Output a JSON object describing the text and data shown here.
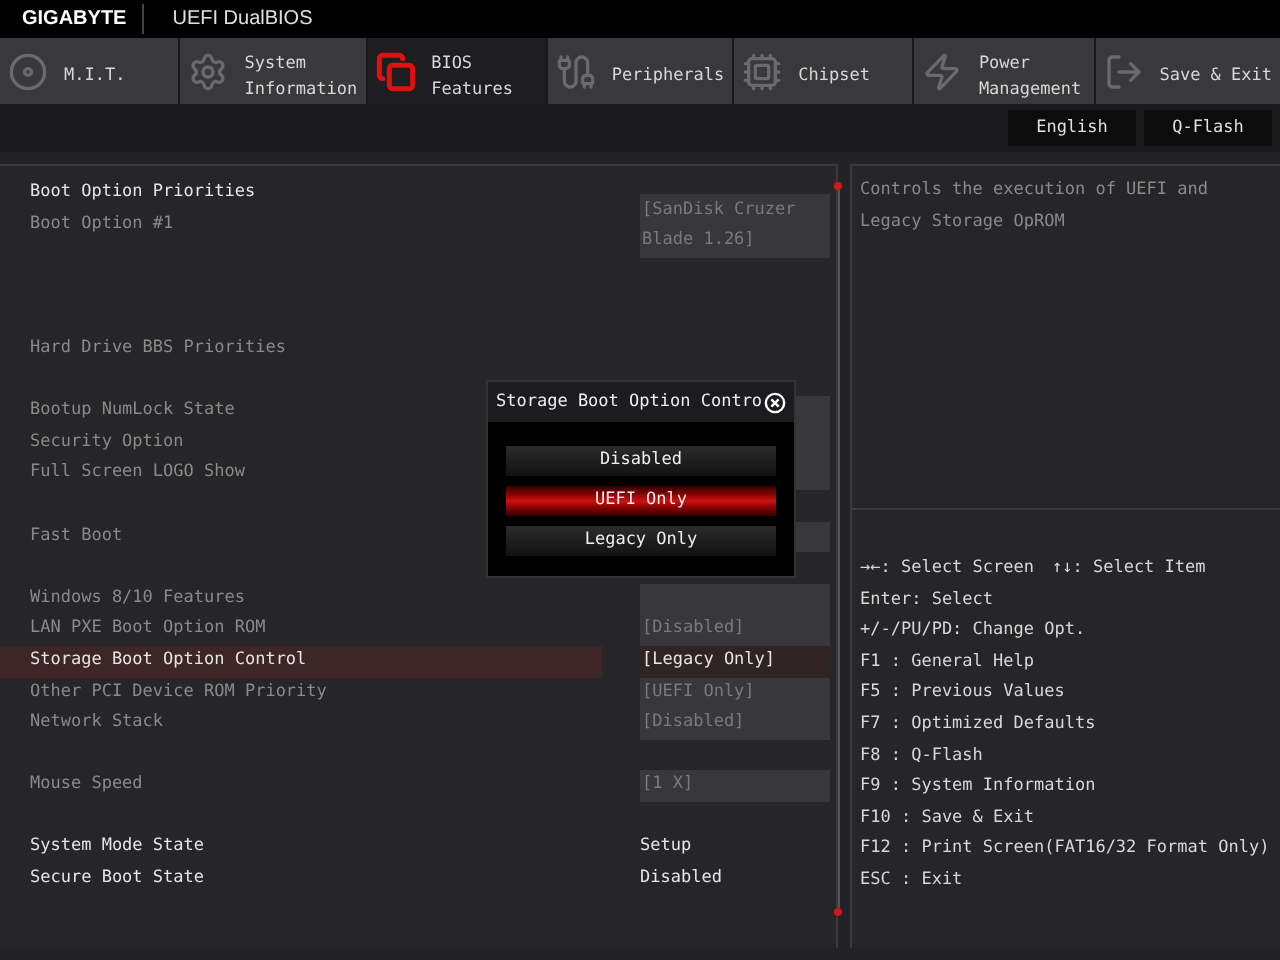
{
  "header": {
    "brand": "GIGABYTE",
    "title": "UEFI DualBIOS"
  },
  "tabs": [
    {
      "lines": [
        "M.I.T."
      ],
      "selected": false
    },
    {
      "lines": [
        "System",
        "Information"
      ],
      "selected": false
    },
    {
      "lines": [
        "BIOS",
        "Features"
      ],
      "selected": true
    },
    {
      "lines": [
        "Peripherals"
      ],
      "selected": false
    },
    {
      "lines": [
        "Chipset"
      ],
      "selected": false
    },
    {
      "lines": [
        "Power",
        "Management"
      ],
      "selected": false
    },
    {
      "lines": [
        "Save & Exit"
      ],
      "selected": false
    }
  ],
  "top_buttons": [
    "English",
    "Q-Flash"
  ],
  "settings": [
    {
      "kind": "header",
      "label": "Boot Option Priorities",
      "disabled": false,
      "selected": false
    },
    {
      "kind": "setting",
      "label": "Boot Option #1",
      "value_lines": [
        "[SanDisk Cruzer",
        "Blade 1.26]"
      ],
      "disabled": true,
      "selected": false
    },
    {
      "kind": "spacer"
    },
    {
      "kind": "header",
      "label": "Hard Drive BBS Priorities",
      "disabled": true,
      "selected": false
    },
    {
      "kind": "spacer"
    },
    {
      "kind": "setting",
      "label": "Bootup NumLock State",
      "disabled": true,
      "selected": false
    },
    {
      "kind": "setting",
      "label": "Security Option",
      "disabled": true,
      "selected": false
    },
    {
      "kind": "setting",
      "label": "Full Screen LOGO Show",
      "disabled": true,
      "selected": false
    },
    {
      "kind": "spacer"
    },
    {
      "kind": "setting",
      "label": "Fast Boot",
      "disabled": true,
      "selected": false
    },
    {
      "kind": "spacer"
    },
    {
      "kind": "setting",
      "label": "Windows 8/10 Features",
      "disabled": true,
      "selected": false
    },
    {
      "kind": "setting",
      "label": "LAN PXE Boot Option ROM",
      "value_lines": [
        "[Disabled]"
      ],
      "disabled": true,
      "selected": false
    },
    {
      "kind": "setting",
      "label": "Storage Boot Option Control",
      "value_lines": [
        "[Legacy Only]"
      ],
      "disabled": false,
      "selected": true
    },
    {
      "kind": "setting",
      "label": "Other PCI Device ROM Priority",
      "value_lines": [
        "[UEFI Only]"
      ],
      "disabled": true,
      "selected": false
    },
    {
      "kind": "setting",
      "label": "Network Stack",
      "value_lines": [
        "[Disabled]"
      ],
      "disabled": true,
      "selected": false
    },
    {
      "kind": "spacer"
    },
    {
      "kind": "setting",
      "label": "Mouse Speed",
      "value_lines": [
        "[1 X]"
      ],
      "disabled": true,
      "selected": false
    },
    {
      "kind": "spacer"
    },
    {
      "kind": "info",
      "label": "System Mode State",
      "value_lines": [
        "Setup"
      ],
      "disabled": false,
      "selected": false
    },
    {
      "kind": "info",
      "label": "Secure Boot State",
      "value_lines": [
        "Disabled"
      ],
      "disabled": false,
      "selected": false
    }
  ],
  "help_text": [
    "Controls the execution of UEFI and",
    "Legacy Storage OpROM"
  ],
  "key_help": [
    [
      "→←: Select Screen",
      "↑↓: Select Item"
    ],
    [
      "Enter: Select"
    ],
    [
      "+/-/PU/PD: Change Opt."
    ],
    [
      "F1  : General Help"
    ],
    [
      "F5  : Previous Values"
    ],
    [
      "F7  : Optimized Defaults"
    ],
    [
      "F8  : Q-Flash"
    ],
    [
      "F9  : System Information"
    ],
    [
      "F10 : Save & Exit"
    ],
    [
      "F12 : Print Screen(FAT16/32 Format Only)"
    ],
    [
      "ESC : Exit"
    ]
  ],
  "popup": {
    "title": "Storage Boot Option Contro",
    "options": [
      {
        "label": "Disabled",
        "selected": false
      },
      {
        "label": "UEFI Only",
        "selected": true
      },
      {
        "label": "Legacy Only",
        "selected": false
      }
    ]
  }
}
